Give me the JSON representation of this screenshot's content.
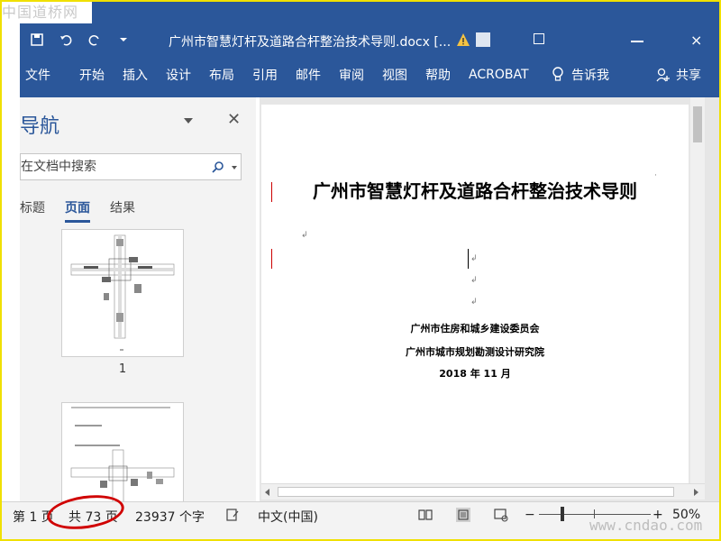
{
  "watermark": {
    "top": "中国道桥网",
    "bottom": "www.cndao.com"
  },
  "window": {
    "title": "广州市智慧灯杆及道路合杆整治技术导则.docx [..."
  },
  "ribbon": {
    "tabs": [
      "文件",
      "开始",
      "插入",
      "设计",
      "布局",
      "引用",
      "邮件",
      "审阅",
      "视图",
      "帮助",
      "ACROBAT"
    ],
    "tell_me": "告诉我",
    "share": "共享"
  },
  "nav": {
    "title": "导航",
    "search_placeholder": "在文档中搜索",
    "tabs": [
      "标题",
      "页面",
      "结果"
    ],
    "active_tab": "页面",
    "thumb_page_label": "1"
  },
  "document": {
    "title": "广州市智慧灯杆及道路合杆整治技术导则",
    "org1": "广州市住房和城乡建设委员会",
    "org2": "广州市城市规划勘测设计研究院",
    "date": "2018 年 11 月",
    "para_mark": "↲"
  },
  "statusbar": {
    "page": "第 1 页",
    "total": "共 73 页",
    "words": "23937 个字",
    "language": "中文(中国)",
    "zoom": "50%",
    "zoom_fraction": 0.5
  },
  "colors": {
    "accent": "#2b579a",
    "highlight": "#d00000",
    "frame": "#f0e000"
  }
}
